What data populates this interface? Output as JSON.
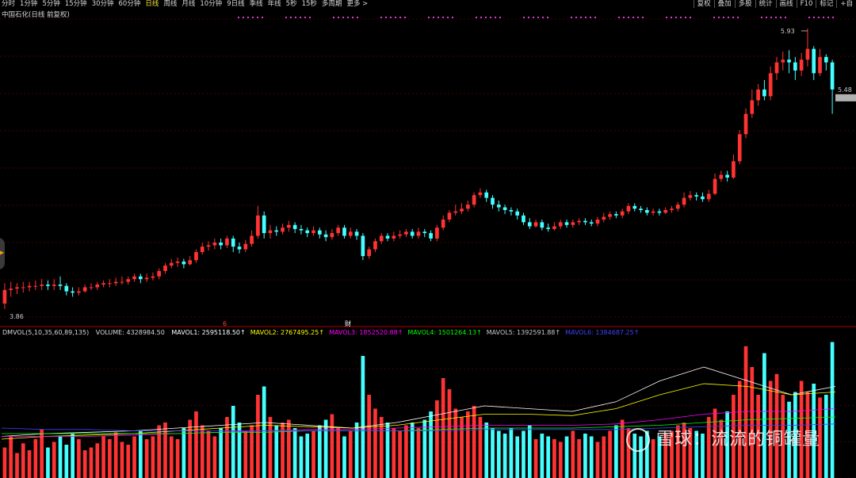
{
  "toolbar": {
    "periods": [
      "分时",
      "1分钟",
      "5分钟",
      "15分钟",
      "30分钟",
      "60分钟",
      "日线",
      "周线",
      "月线",
      "10分钟",
      "9日线",
      "季线",
      "年线",
      "5秒",
      "15秒",
      "多周期",
      "更多 >"
    ],
    "active_period": "日线",
    "tools": [
      "复权",
      "叠加",
      "多股",
      "统计",
      "画线",
      "F10",
      "标记",
      "+自"
    ]
  },
  "chart_title": "中国石化(日线 前复权)",
  "dmvol": {
    "indicator": "DMVOL(5,10,35,60,89,135)",
    "volume": "VOLUME: 4328984.50",
    "mavols": [
      {
        "text": "MAVOL1: 2595118.50↑",
        "color": "#ffffff"
      },
      {
        "text": "MAVOL2: 2767495.25↑",
        "color": "#ffff00"
      },
      {
        "text": "MAVOL3: 1852520.88↑",
        "color": "#ff00ff"
      },
      {
        "text": "MAVOL4: 1501264.13↑",
        "color": "#00ff00"
      },
      {
        "text": "MAVOL5: 1392591.88↑",
        "color": "#c8c8c8"
      },
      {
        "text": "MAVOL6: 1384687.25↑",
        "color": "#4040ff"
      }
    ]
  },
  "chart_data": {
    "type": "candlestick",
    "price_high_label": "5.93",
    "price_low_label": "3.86",
    "last_price_label": "5.48",
    "markers": [
      "6",
      "财"
    ],
    "colors": {
      "up": "#ff3333",
      "down": "#44ffff",
      "bg": "#000000",
      "grid": "#8b0000"
    },
    "candles": [
      [
        3.9,
        4.0,
        3.86,
        4.05
      ],
      [
        4.0,
        4.01,
        3.95,
        4.06
      ],
      [
        4.01,
        4.02,
        3.97,
        4.05
      ],
      [
        4.02,
        4.02,
        3.98,
        4.06
      ],
      [
        4.02,
        4.03,
        3.99,
        4.06
      ],
      [
        4.03,
        4.03,
        4.0,
        4.07
      ],
      [
        4.03,
        4.04,
        4.0,
        4.08
      ],
      [
        4.04,
        4.03,
        4.0,
        4.07
      ],
      [
        4.03,
        4.04,
        4.0,
        4.08
      ],
      [
        4.04,
        4.03,
        4.0,
        4.1
      ],
      [
        4.03,
        3.99,
        3.96,
        4.05
      ],
      [
        3.99,
        3.98,
        3.95,
        4.02
      ],
      [
        3.98,
        3.99,
        3.96,
        4.02
      ],
      [
        3.99,
        4.02,
        3.98,
        4.04
      ],
      [
        4.02,
        4.02,
        4.0,
        4.05
      ],
      [
        4.02,
        4.04,
        4.0,
        4.06
      ],
      [
        4.04,
        4.05,
        4.02,
        4.07
      ],
      [
        4.05,
        4.05,
        4.02,
        4.08
      ],
      [
        4.05,
        4.06,
        4.03,
        4.09
      ],
      [
        4.06,
        4.06,
        4.04,
        4.1
      ],
      [
        4.06,
        4.08,
        4.04,
        4.1
      ],
      [
        4.08,
        4.1,
        4.06,
        4.12
      ],
      [
        4.1,
        4.08,
        4.05,
        4.12
      ],
      [
        4.08,
        4.09,
        4.06,
        4.12
      ],
      [
        4.09,
        4.1,
        4.07,
        4.13
      ],
      [
        4.1,
        4.14,
        4.08,
        4.16
      ],
      [
        4.14,
        4.18,
        4.12,
        4.2
      ],
      [
        4.18,
        4.2,
        4.16,
        4.23
      ],
      [
        4.2,
        4.21,
        4.17,
        4.24
      ],
      [
        4.21,
        4.19,
        4.16,
        4.23
      ],
      [
        4.19,
        4.22,
        4.18,
        4.25
      ],
      [
        4.22,
        4.28,
        4.2,
        4.3
      ],
      [
        4.28,
        4.32,
        4.26,
        4.35
      ],
      [
        4.32,
        4.33,
        4.29,
        4.36
      ],
      [
        4.33,
        4.35,
        4.3,
        4.38
      ],
      [
        4.35,
        4.33,
        4.3,
        4.38
      ],
      [
        4.33,
        4.38,
        4.31,
        4.4
      ],
      [
        4.38,
        4.32,
        4.28,
        4.4
      ],
      [
        4.32,
        4.3,
        4.27,
        4.35
      ],
      [
        4.3,
        4.34,
        4.28,
        4.37
      ],
      [
        4.34,
        4.4,
        4.32,
        4.44
      ],
      [
        4.4,
        4.55,
        4.38,
        4.62
      ],
      [
        4.55,
        4.42,
        4.38,
        4.58
      ],
      [
        4.42,
        4.44,
        4.38,
        4.48
      ],
      [
        4.44,
        4.43,
        4.4,
        4.47
      ],
      [
        4.43,
        4.46,
        4.41,
        4.49
      ],
      [
        4.46,
        4.48,
        4.43,
        4.51
      ],
      [
        4.48,
        4.45,
        4.42,
        4.5
      ],
      [
        4.45,
        4.44,
        4.41,
        4.48
      ],
      [
        4.44,
        4.42,
        4.39,
        4.46
      ],
      [
        4.42,
        4.44,
        4.4,
        4.47
      ],
      [
        4.44,
        4.41,
        4.38,
        4.46
      ],
      [
        4.41,
        4.39,
        4.36,
        4.44
      ],
      [
        4.39,
        4.42,
        4.37,
        4.45
      ],
      [
        4.42,
        4.46,
        4.4,
        4.48
      ],
      [
        4.46,
        4.4,
        4.38,
        4.48
      ],
      [
        4.4,
        4.43,
        4.38,
        4.46
      ],
      [
        4.43,
        4.4,
        4.37,
        4.45
      ],
      [
        4.4,
        4.25,
        4.22,
        4.42
      ],
      [
        4.25,
        4.3,
        4.23,
        4.32
      ],
      [
        4.3,
        4.36,
        4.28,
        4.38
      ],
      [
        4.36,
        4.4,
        4.34,
        4.42
      ],
      [
        4.4,
        4.38,
        4.36,
        4.42
      ],
      [
        4.38,
        4.4,
        4.36,
        4.43
      ],
      [
        4.4,
        4.41,
        4.38,
        4.44
      ],
      [
        4.41,
        4.43,
        4.39,
        4.45
      ],
      [
        4.43,
        4.4,
        4.38,
        4.45
      ],
      [
        4.4,
        4.43,
        4.38,
        4.46
      ],
      [
        4.43,
        4.42,
        4.39,
        4.45
      ],
      [
        4.42,
        4.38,
        4.36,
        4.44
      ],
      [
        4.38,
        4.46,
        4.36,
        4.48
      ],
      [
        4.46,
        4.52,
        4.44,
        4.55
      ],
      [
        4.52,
        4.57,
        4.5,
        4.59
      ],
      [
        4.57,
        4.58,
        4.55,
        4.63
      ],
      [
        4.58,
        4.6,
        4.56,
        4.64
      ],
      [
        4.6,
        4.63,
        4.58,
        4.66
      ],
      [
        4.63,
        4.7,
        4.61,
        4.72
      ],
      [
        4.7,
        4.72,
        4.68,
        4.75
      ],
      [
        4.72,
        4.68,
        4.65,
        4.74
      ],
      [
        4.68,
        4.63,
        4.6,
        4.7
      ],
      [
        4.63,
        4.61,
        4.58,
        4.66
      ],
      [
        4.61,
        4.59,
        4.56,
        4.63
      ],
      [
        4.59,
        4.58,
        4.55,
        4.61
      ],
      [
        4.58,
        4.55,
        4.52,
        4.6
      ],
      [
        4.55,
        4.5,
        4.48,
        4.57
      ],
      [
        4.5,
        4.47,
        4.45,
        4.53
      ],
      [
        4.47,
        4.5,
        4.46,
        4.52
      ],
      [
        4.5,
        4.46,
        4.44,
        4.52
      ],
      [
        4.46,
        4.45,
        4.43,
        4.49
      ],
      [
        4.45,
        4.47,
        4.44,
        4.5
      ],
      [
        4.47,
        4.5,
        4.45,
        4.52
      ],
      [
        4.5,
        4.48,
        4.46,
        4.52
      ],
      [
        4.48,
        4.5,
        4.46,
        4.52
      ],
      [
        4.5,
        4.51,
        4.48,
        4.53
      ],
      [
        4.51,
        4.5,
        4.48,
        4.53
      ],
      [
        4.5,
        4.49,
        4.47,
        4.52
      ],
      [
        4.49,
        4.52,
        4.47,
        4.54
      ],
      [
        4.52,
        4.54,
        4.5,
        4.57
      ],
      [
        4.54,
        4.56,
        4.52,
        4.58
      ],
      [
        4.56,
        4.55,
        4.53,
        4.58
      ],
      [
        4.55,
        4.58,
        4.53,
        4.6
      ],
      [
        4.58,
        4.62,
        4.56,
        4.64
      ],
      [
        4.62,
        4.6,
        4.58,
        4.64
      ],
      [
        4.6,
        4.59,
        4.57,
        4.62
      ],
      [
        4.59,
        4.57,
        4.55,
        4.61
      ],
      [
        4.57,
        4.58,
        4.55,
        4.6
      ],
      [
        4.58,
        4.57,
        4.55,
        4.6
      ],
      [
        4.57,
        4.59,
        4.56,
        4.61
      ],
      [
        4.59,
        4.6,
        4.57,
        4.62
      ],
      [
        4.6,
        4.63,
        4.58,
        4.65
      ],
      [
        4.63,
        4.68,
        4.61,
        4.72
      ],
      [
        4.68,
        4.7,
        4.66,
        4.73
      ],
      [
        4.7,
        4.69,
        4.66,
        4.72
      ],
      [
        4.69,
        4.67,
        4.65,
        4.72
      ],
      [
        4.67,
        4.71,
        4.65,
        4.74
      ],
      [
        4.71,
        4.82,
        4.7,
        4.86
      ],
      [
        4.82,
        4.85,
        4.8,
        4.88
      ],
      [
        4.85,
        4.83,
        4.8,
        4.88
      ],
      [
        4.83,
        4.95,
        4.82,
        5.0
      ],
      [
        4.95,
        5.15,
        4.93,
        5.18
      ],
      [
        5.15,
        5.3,
        5.12,
        5.34
      ],
      [
        5.3,
        5.4,
        5.27,
        5.48
      ],
      [
        5.4,
        5.48,
        5.36,
        5.52
      ],
      [
        5.48,
        5.43,
        5.4,
        5.55
      ],
      [
        5.43,
        5.6,
        5.4,
        5.65
      ],
      [
        5.6,
        5.68,
        5.55,
        5.72
      ],
      [
        5.68,
        5.7,
        5.62,
        5.76
      ],
      [
        5.7,
        5.68,
        5.6,
        5.77
      ],
      [
        5.68,
        5.62,
        5.55,
        5.72
      ],
      [
        5.62,
        5.7,
        5.58,
        5.75
      ],
      [
        5.7,
        5.78,
        5.65,
        5.93
      ],
      [
        5.78,
        5.6,
        5.55,
        5.8
      ],
      [
        5.6,
        5.72,
        5.58,
        5.78
      ],
      [
        5.72,
        5.68,
        5.62,
        5.74
      ],
      [
        5.68,
        5.48,
        5.3,
        5.7
      ]
    ],
    "volume": [
      0.22,
      0.3,
      0.18,
      0.25,
      0.2,
      0.28,
      0.35,
      0.22,
      0.26,
      0.3,
      0.24,
      0.32,
      0.28,
      0.2,
      0.22,
      0.25,
      0.3,
      0.28,
      0.33,
      0.26,
      0.24,
      0.3,
      0.34,
      0.28,
      0.3,
      0.38,
      0.4,
      0.3,
      0.28,
      0.36,
      0.42,
      0.48,
      0.38,
      0.34,
      0.3,
      0.36,
      0.44,
      0.52,
      0.4,
      0.34,
      0.38,
      0.6,
      0.66,
      0.44,
      0.38,
      0.4,
      0.42,
      0.36,
      0.3,
      0.32,
      0.34,
      0.38,
      0.42,
      0.46,
      0.36,
      0.3,
      0.34,
      0.4,
      0.88,
      0.6,
      0.5,
      0.44,
      0.4,
      0.36,
      0.34,
      0.38,
      0.4,
      0.36,
      0.42,
      0.48,
      0.56,
      0.72,
      0.64,
      0.5,
      0.44,
      0.48,
      0.52,
      0.44,
      0.4,
      0.36,
      0.34,
      0.32,
      0.36,
      0.3,
      0.34,
      0.38,
      0.28,
      0.32,
      0.3,
      0.28,
      0.26,
      0.3,
      0.34,
      0.28,
      0.32,
      0.3,
      0.26,
      0.3,
      0.34,
      0.38,
      0.42,
      0.36,
      0.32,
      0.3,
      0.34,
      0.28,
      0.3,
      0.32,
      0.34,
      0.38,
      0.4,
      0.36,
      0.34,
      0.32,
      0.44,
      0.5,
      0.42,
      0.48,
      0.6,
      0.7,
      0.95,
      0.8,
      0.6,
      0.9,
      0.7,
      0.75,
      0.6,
      0.55,
      0.62,
      0.7,
      0.62,
      0.68,
      0.58,
      0.6,
      0.98
    ],
    "ma_lines_volume": {
      "white": [
        0.3,
        0.32,
        0.33,
        0.34,
        0.36,
        0.38,
        0.4,
        0.38,
        0.36,
        0.4,
        0.46,
        0.52,
        0.5,
        0.48,
        0.55,
        0.7,
        0.8,
        0.7,
        0.6,
        0.66
      ],
      "yellow": [
        0.28,
        0.3,
        0.31,
        0.32,
        0.34,
        0.36,
        0.38,
        0.37,
        0.36,
        0.38,
        0.42,
        0.46,
        0.46,
        0.45,
        0.5,
        0.6,
        0.68,
        0.66,
        0.6,
        0.62
      ],
      "magenta": [
        0.3,
        0.3,
        0.3,
        0.31,
        0.32,
        0.33,
        0.34,
        0.35,
        0.35,
        0.36,
        0.37,
        0.38,
        0.38,
        0.38,
        0.39,
        0.42,
        0.46,
        0.48,
        0.48,
        0.5
      ],
      "green": [
        0.32,
        0.32,
        0.32,
        0.32,
        0.32,
        0.33,
        0.33,
        0.34,
        0.34,
        0.34,
        0.35,
        0.36,
        0.36,
        0.36,
        0.37,
        0.38,
        0.4,
        0.42,
        0.43,
        0.44
      ],
      "blue": [
        0.36,
        0.35,
        0.35,
        0.34,
        0.34,
        0.34,
        0.34,
        0.34,
        0.34,
        0.34,
        0.34,
        0.35,
        0.35,
        0.35,
        0.35,
        0.36,
        0.37,
        0.38,
        0.38,
        0.39
      ]
    }
  },
  "watermark": "雪球：流流的铜罐量"
}
